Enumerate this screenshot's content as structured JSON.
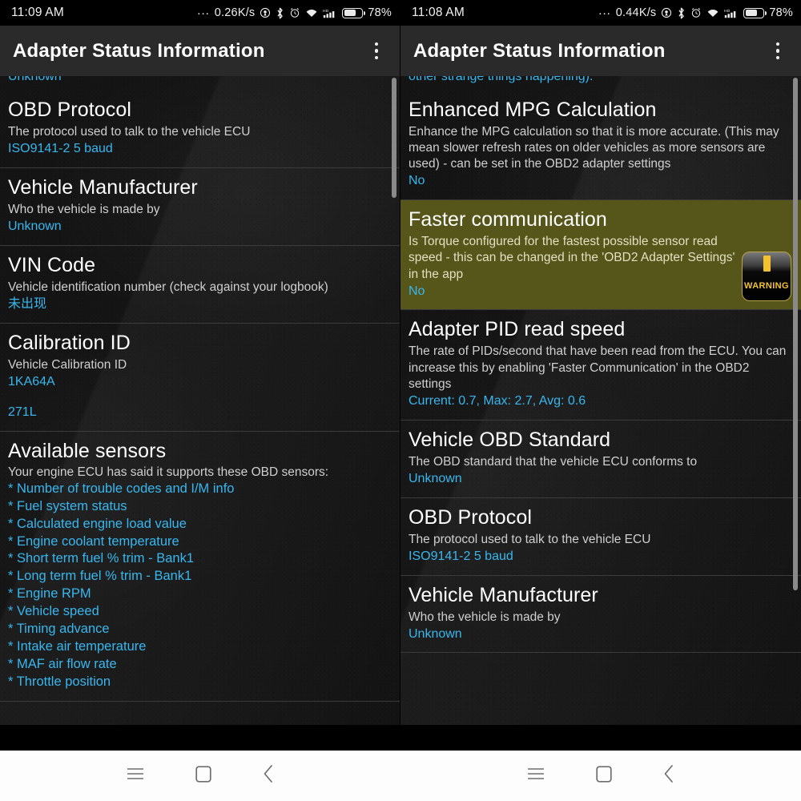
{
  "panels": [
    {
      "id": "left",
      "status": {
        "clock": "11:09 AM",
        "dots": "...",
        "net_speed": "0.26K/s",
        "battery_pct": "78%",
        "icons": [
          "location-icon",
          "bluetooth-icon",
          "alarm-icon",
          "wifi-icon",
          "hd-signal-icon",
          "battery-icon"
        ]
      },
      "appbar": {
        "title": "Adapter Status Information",
        "menu": "overflow-menu"
      },
      "clipped_top": "Unknown",
      "rows": [
        {
          "heading": "OBD Protocol",
          "desc": "The protocol used to talk to the vehicle ECU",
          "value": "ISO9141-2 5 baud"
        },
        {
          "heading": "Vehicle Manufacturer",
          "desc": "Who the vehicle is made by",
          "value": "Unknown"
        },
        {
          "heading": "VIN Code",
          "desc": "Vehicle identification number (check against your logbook)",
          "value": "未出现"
        },
        {
          "heading": "Calibration ID",
          "desc": "Vehicle Calibration ID",
          "value": "1KA64A",
          "value2": "271L"
        }
      ],
      "sensors_section": {
        "heading": "Available sensors",
        "desc": "Your engine ECU has said it supports these OBD sensors:",
        "items": [
          "* Number of trouble codes and I/M info",
          "* Fuel system status",
          "* Calculated engine load value",
          "* Engine coolant temperature",
          "* Short term fuel % trim - Bank1",
          "* Long term fuel % trim - Bank1",
          "* Engine RPM",
          "* Vehicle speed",
          "* Timing advance",
          "* Intake air temperature",
          "* MAF air flow rate",
          "* Throttle position"
        ]
      }
    },
    {
      "id": "right",
      "status": {
        "clock": "11:08 AM",
        "dots": "...",
        "net_speed": "0.44K/s",
        "battery_pct": "78%",
        "icons": [
          "location-icon",
          "bluetooth-icon",
          "alarm-icon",
          "wifi-icon",
          "hd-signal-icon",
          "battery-icon"
        ]
      },
      "appbar": {
        "title": "Adapter Status Information",
        "menu": "overflow-menu"
      },
      "clipped_top": "other strange things happening).",
      "rows": [
        {
          "heading": "Enhanced MPG Calculation",
          "desc": "Enhance the MPG calculation so that it is more accurate. (This may mean slower refresh rates on older vehicles as more sensors are used) - can be set in the OBD2 adapter settings",
          "value": "No"
        },
        {
          "heading": "Faster communication",
          "desc": "Is Torque configured for the fastest possible sensor read speed - this can be changed in the 'OBD2 Adapter Settings' in the app",
          "value": "No",
          "highlighted": true,
          "badge": {
            "icon": "warning-icon",
            "label": "WARNING"
          }
        },
        {
          "heading": "Adapter PID read speed",
          "desc": "The rate of PIDs/second that have been read from the ECU. You can increase this by enabling 'Faster Communication' in the OBD2 settings",
          "value": "Current: 0.7, Max: 2.7, Avg: 0.6"
        },
        {
          "heading": "Vehicle OBD Standard",
          "desc": "The OBD standard that the vehicle ECU conforms to",
          "value": "Unknown"
        },
        {
          "heading": "OBD Protocol",
          "desc": "The protocol used to talk to the vehicle ECU",
          "value": "ISO9141-2 5 baud"
        },
        {
          "heading": "Vehicle Manufacturer",
          "desc": "Who the vehicle is made by",
          "value": "Unknown"
        }
      ]
    }
  ],
  "navbar": {
    "buttons": [
      "menu-icon",
      "home-icon",
      "back-icon"
    ]
  },
  "colors": {
    "accent_blue": "#37b7ef",
    "highlight_olive": "#56551a",
    "appbar_bg": "#2a2a2a",
    "warning_yellow": "#f2c230"
  }
}
